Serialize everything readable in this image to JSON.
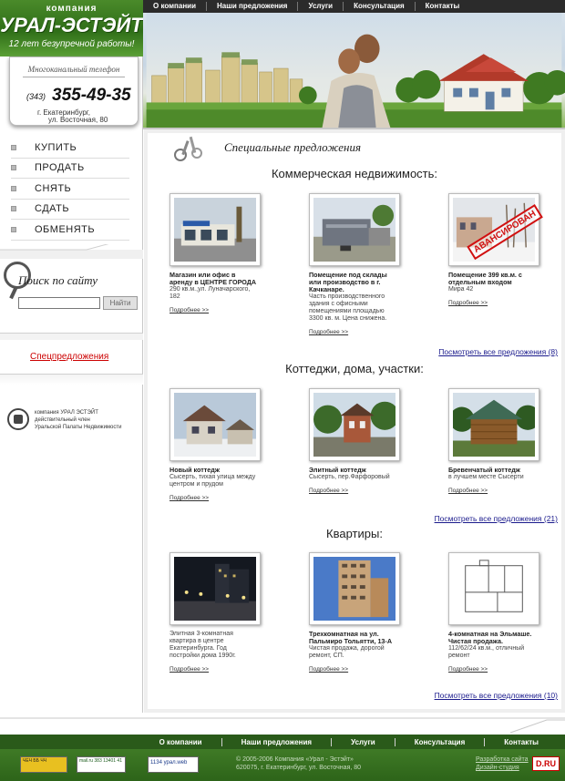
{
  "company": {
    "label": "компания",
    "name": "УРАЛ-ЭСТЭЙТ",
    "slogan": "12 лет безупречной работы!"
  },
  "contact": {
    "phone_label": "Многоканальный телефон",
    "phone_code": "(343)",
    "phone_number": "355-49-35",
    "address_line1": "г. Екатеринбург,",
    "address_line2": "ул. Восточная, 80"
  },
  "top_nav": [
    "О компании",
    "Наши предложения",
    "Услуги",
    "Консультация",
    "Контакты"
  ],
  "main_menu": [
    "КУПИТЬ",
    "ПРОДАТЬ",
    "СНЯТЬ",
    "СДАТЬ",
    "ОБМЕНЯТЬ"
  ],
  "search": {
    "title": "Поиск по сайту",
    "value": "",
    "button": "Найти"
  },
  "special_link": "Спецпредложения",
  "member_text": [
    "компания УРАЛ ЭСТЭЙТ",
    "действительный член",
    "Уральской Палаты Недвижимости"
  ],
  "page_title": "Специальные предложения",
  "sections": [
    {
      "title": "Коммерческая недвижимость:",
      "see_all": "Посмотреть все предложения (8)",
      "items": [
        {
          "title": "Магазин или офис в аренду в ЦЕНТРЕ ГОРОДА",
          "desc": "290 кв.м.,ул. Луначарского, 182",
          "more": "Подробнее >>",
          "photo": "shop-photo"
        },
        {
          "title": "Помещение под склады или производство в г. Качканаре.",
          "desc": "Часть производственного здания с офисными помещениями площадью 3300 кв. м. Цена снижена.",
          "more": "Подробнее >>",
          "photo": "warehouse-photo"
        },
        {
          "title": "Помещение 399 кв.м. с отдельным входом",
          "desc": "Мира 42",
          "more": "Подробнее >>",
          "photo": "sold-building-photo",
          "stamp": "АВАНСИРОВАН"
        }
      ]
    },
    {
      "title": "Коттеджи, дома, участки:",
      "see_all": "Посмотреть все предложения (21)",
      "items": [
        {
          "title": "Новый коттедж",
          "desc": "Сысерть, тихая улица между центром и прудом",
          "more": "Подробнее >>",
          "photo": "cottage-photo"
        },
        {
          "title": "Элитный коттедж",
          "desc": "Сысерть, пер.Фарфоровый",
          "more": "Подробнее >>",
          "photo": "elite-cottage-photo"
        },
        {
          "title": "Бревенчатый коттедж",
          "desc": "в лучшем месте Сысерти",
          "more": "Подробнее >>",
          "photo": "log-cottage-photo"
        }
      ]
    },
    {
      "title": "Квартиры:",
      "see_all": "Посмотреть все предложения (10)",
      "items": [
        {
          "title": "",
          "desc": "Элитная 3-комнатная квартира в центре Екатеринбурга. Год постройки дома 1990г.",
          "more": "Подробнее >>",
          "photo": "night-street-photo"
        },
        {
          "title": "Трехкомнатная на ул. Пальмиро Тольятти, 13-А",
          "desc": "Чистая продажа, дорогой ремонт, СП.",
          "more": "Подробнее >>",
          "photo": "tower-photo"
        },
        {
          "title": "4-комнатная на Эльмаше. Чистая продажа.",
          "desc": "112/62/24 кв.м., отличный ремонт",
          "more": "Подробнее >>",
          "photo": "floorplan-photo"
        }
      ]
    }
  ],
  "footer_nav": [
    "О компании",
    "Наши предложения",
    "Услуги",
    "Консультация",
    "Контакты"
  ],
  "footer": {
    "copyright": "© 2005-2006 Компания «Урал - Эстэйт»",
    "address": "620075, г. Екатеринбург, ул. Восточная, 80",
    "dev1": "Разработка сайта",
    "dev2": "Дизайн-студия",
    "dr_logo": "D.RU",
    "counters": [
      "ЧЕЧ ББ ЧЧ",
      "mail.ru 383 13401 41",
      "1134 урал.web"
    ]
  },
  "colors": {
    "brand_green": "#2f6e18",
    "nav_dark": "#2b2b2b",
    "link_blue": "#1a1a8c",
    "special_red": "#cc0000"
  }
}
